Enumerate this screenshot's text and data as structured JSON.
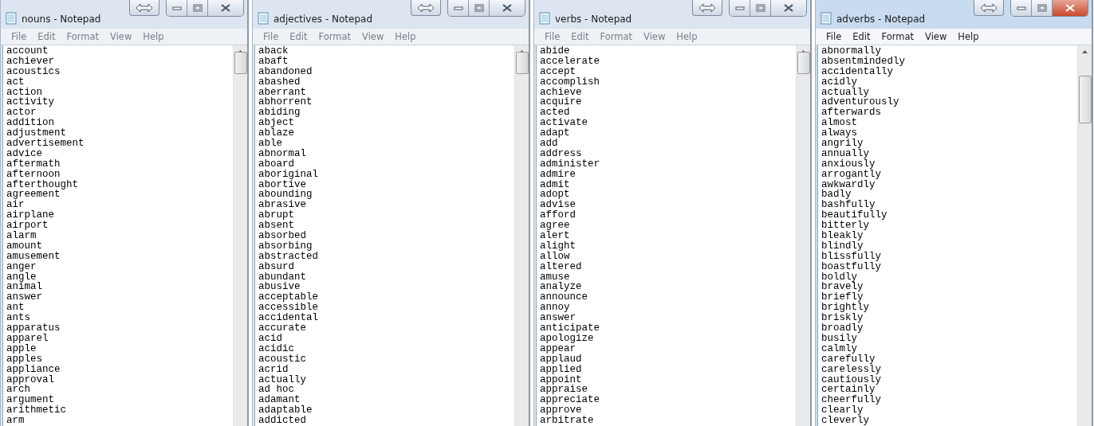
{
  "windows": [
    {
      "title": "nouns - Notepad",
      "active": false,
      "menu": [
        "File",
        "Edit",
        "Format",
        "View",
        "Help"
      ],
      "lines": [
        "account",
        "achiever",
        "acoustics",
        "act",
        "action",
        "activity",
        "actor",
        "addition",
        "adjustment",
        "advertisement",
        "advice",
        "aftermath",
        "afternoon",
        "afterthought",
        "agreement",
        "air",
        "airplane",
        "airport",
        "alarm",
        "amount",
        "amusement",
        "anger",
        "angle",
        "animal",
        "answer",
        "ant",
        "ants",
        "apparatus",
        "apparel",
        "apple",
        "apples",
        "appliance",
        "approval",
        "arch",
        "argument",
        "arithmetic",
        "arm"
      ]
    },
    {
      "title": "adjectives - Notepad",
      "active": false,
      "menu": [
        "File",
        "Edit",
        "Format",
        "View",
        "Help"
      ],
      "lines": [
        "aback",
        "abaft",
        "abandoned",
        "abashed",
        "aberrant",
        "abhorrent",
        "abiding",
        "abject",
        "ablaze",
        "able",
        "abnormal",
        "aboard",
        "aboriginal",
        "abortive",
        "abounding",
        "abrasive",
        "abrupt",
        "absent",
        "absorbed",
        "absorbing",
        "abstracted",
        "absurd",
        "abundant",
        "abusive",
        "acceptable",
        "accessible",
        "accidental",
        "accurate",
        "acid",
        "acidic",
        "acoustic",
        "acrid",
        "actually",
        "ad hoc",
        "adamant",
        "adaptable",
        "addicted"
      ]
    },
    {
      "title": "verbs - Notepad",
      "active": false,
      "menu": [
        "File",
        "Edit",
        "Format",
        "View",
        "Help"
      ],
      "lines": [
        "abide",
        "accelerate",
        "accept",
        "accomplish",
        "achieve",
        "acquire",
        "acted",
        "activate",
        "adapt",
        "add",
        "address",
        "administer",
        "admire",
        "admit",
        "adopt",
        "advise",
        "afford",
        "agree",
        "alert",
        "alight",
        "allow",
        "altered",
        "amuse",
        "analyze",
        "announce",
        "annoy",
        "answer",
        "anticipate",
        "apologize",
        "appear",
        "applaud",
        "applied",
        "appoint",
        "appraise",
        "appreciate",
        "approve",
        "arbitrate"
      ]
    },
    {
      "title": "adverbs - Notepad",
      "active": true,
      "menu": [
        "File",
        "Edit",
        "Format",
        "View",
        "Help"
      ],
      "lines": [
        "abnormally",
        "absentmindedly",
        "accidentally",
        "acidly",
        "actually",
        "adventurously",
        "afterwards",
        "almost",
        "always",
        "angrily",
        "annually",
        "anxiously",
        "arrogantly",
        "awkwardly",
        "badly",
        "bashfully",
        "beautifully",
        "bitterly",
        "bleakly",
        "blindly",
        "blissfully",
        "boastfully",
        "boldly",
        "bravely",
        "briefly",
        "brightly",
        "briskly",
        "broadly",
        "busily",
        "calmly",
        "carefully",
        "carelessly",
        "cautiously",
        "certainly",
        "cheerfully",
        "clearly",
        "cleverly"
      ]
    }
  ]
}
